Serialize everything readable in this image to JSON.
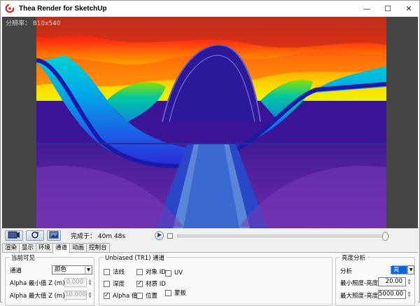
{
  "window": {
    "title": "Thea Render for SketchUp",
    "minimize_glyph": "—",
    "maximize_glyph": "☐",
    "close_glyph": "✕"
  },
  "viewport": {
    "resolution_label": "分辨率： 810x540"
  },
  "toolbar": {
    "status_text": "完成于： 40m 48s",
    "progress_fraction": 1.0
  },
  "tabs": [
    {
      "label": "渲染"
    },
    {
      "label": "显示"
    },
    {
      "label": "环境"
    },
    {
      "label": "通道",
      "active": true
    },
    {
      "label": "动画"
    },
    {
      "label": "控制台"
    }
  ],
  "current_visible": {
    "title": "当前可见",
    "channel_label": "通道",
    "channel_value": "颜色",
    "alpha_min_label": "Alpha 最小值 Z (m)",
    "alpha_min_value": "0.000",
    "alpha_max_label": "Alpha 最大值 Z (m)",
    "alpha_max_value": "10.000"
  },
  "unbiased": {
    "title": "Unbiased (TR1) 通道",
    "checkboxes": [
      {
        "label": "法线",
        "checked": false
      },
      {
        "label": "对象 ID",
        "checked": false
      },
      {
        "label": "UV",
        "checked": false
      },
      {
        "label": "深度",
        "checked": false
      },
      {
        "label": "材质 ID",
        "checked": true
      },
      {
        "label": "Alpha 值",
        "checked": true
      },
      {
        "label": "位置",
        "checked": false
      },
      {
        "label": "蒙板",
        "checked": false
      }
    ]
  },
  "brightness": {
    "title": "亮度分析",
    "analysis_label": "分析",
    "analysis_value": "亮度",
    "min_label": "最小照度-亮度",
    "min_value": "20.00",
    "max_label": "最大照度-亮度",
    "max_value": "5000.00"
  },
  "colors": {
    "accent": "#0a64d6",
    "title_icon_red": "#e2231a"
  }
}
